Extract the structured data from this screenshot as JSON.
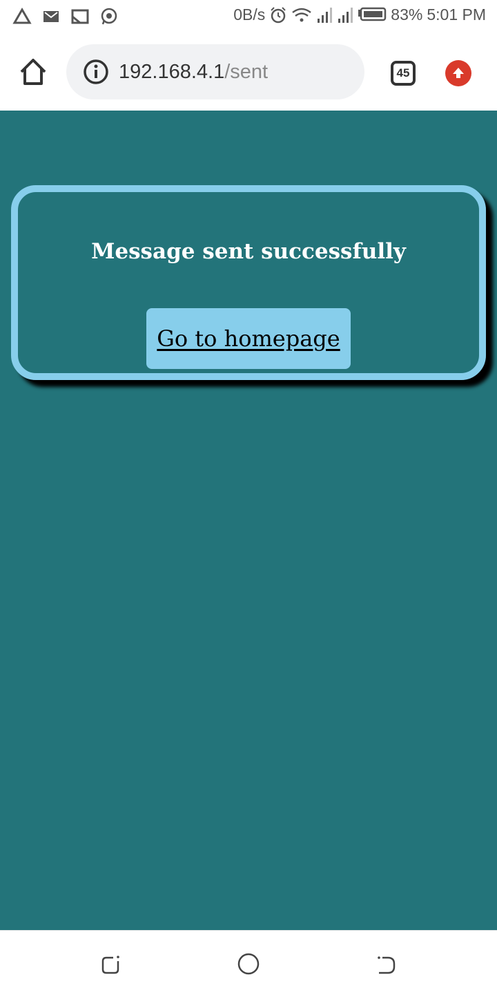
{
  "status_bar": {
    "network_speed": "0B/s",
    "battery": "83%",
    "time": "5:01 PM",
    "icons": [
      "triangle-icon",
      "gmail-icon",
      "cast-icon",
      "whatsapp-icon",
      "alarm-icon",
      "wifi-icon",
      "signal-icon",
      "signal-icon-2",
      "battery-icon"
    ]
  },
  "browser": {
    "url_host": "192.168.4.1",
    "url_path": "/sent",
    "tab_count": "45"
  },
  "page": {
    "message": "Message sent successfully",
    "link_label": "Go to homepage"
  },
  "colors": {
    "page_background": "#23747a",
    "card_border": "#87ceeb",
    "button_background": "#87ceeb",
    "update_icon": "#d93a2b"
  },
  "nav_bar": {
    "icons": [
      "recents-icon",
      "home-circle-icon",
      "back-icon"
    ]
  }
}
